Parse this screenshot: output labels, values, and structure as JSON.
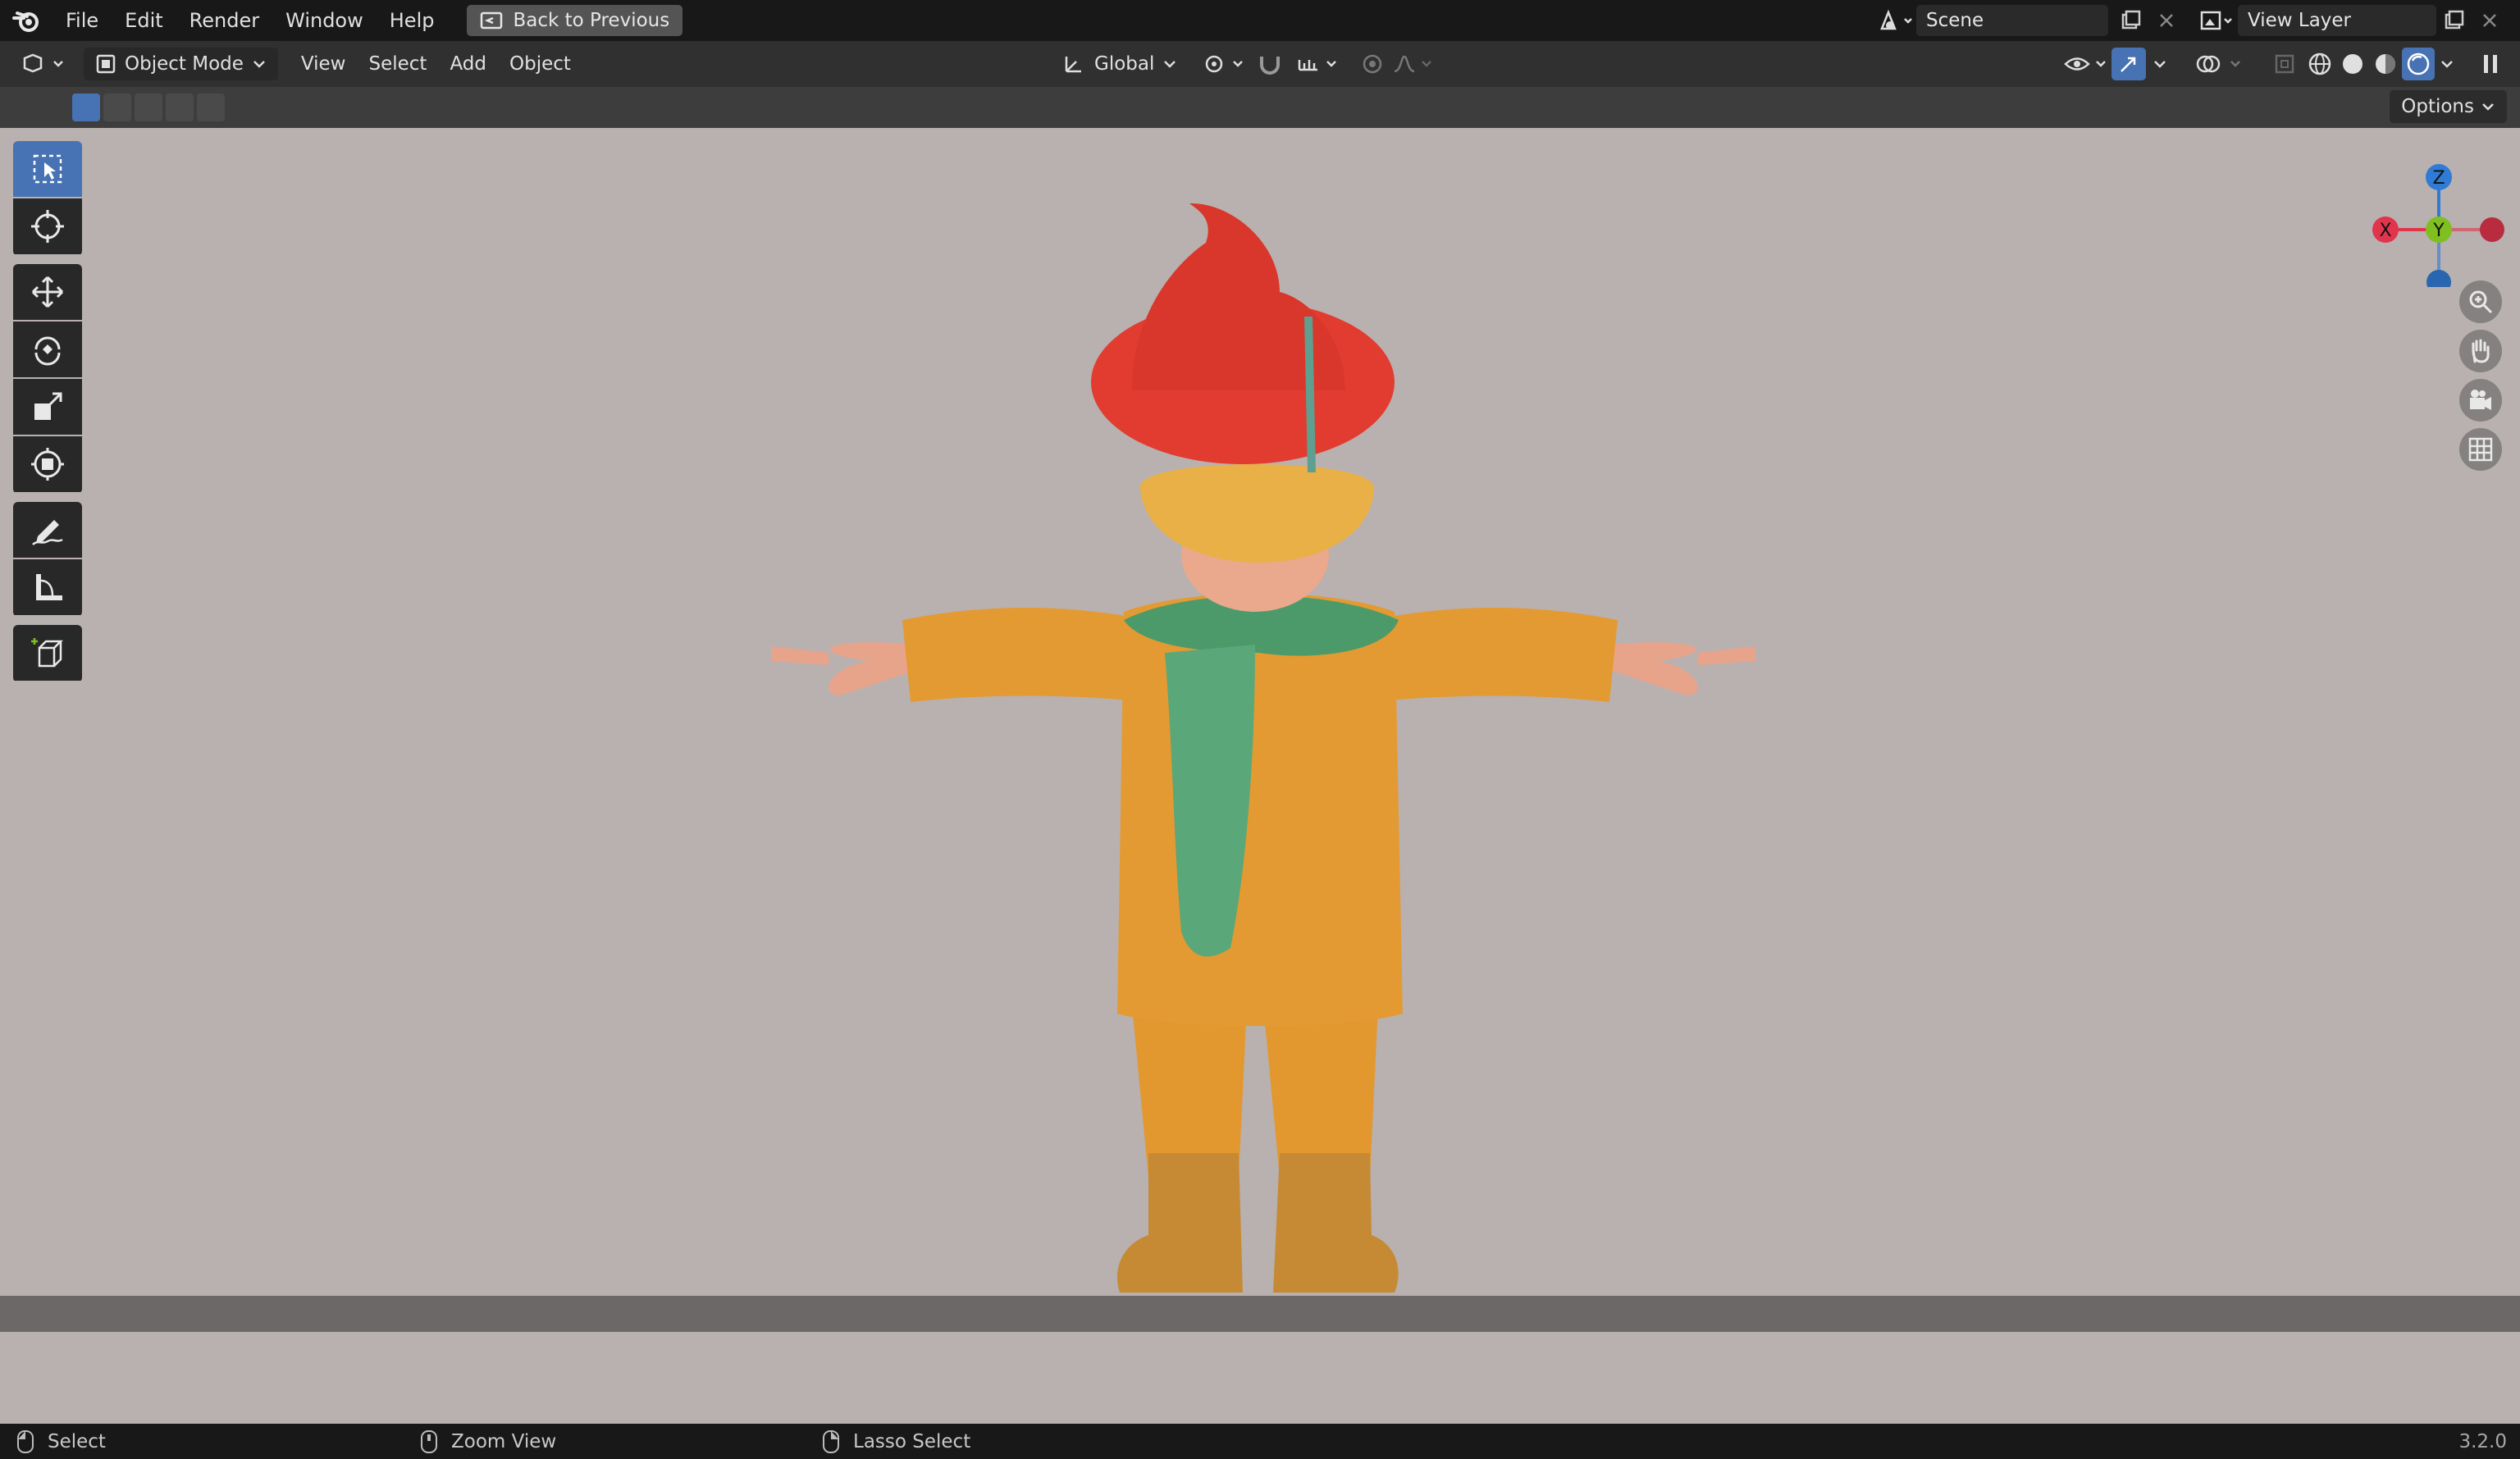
{
  "topbar": {
    "menus": [
      "File",
      "Edit",
      "Render",
      "Window",
      "Help"
    ],
    "back_label": "Back to Previous",
    "scene_label": "Scene",
    "view_layer_label": "View Layer"
  },
  "header": {
    "mode_label": "Object Mode",
    "menus": [
      "View",
      "Select",
      "Add",
      "Object"
    ],
    "orientation_label": "Global"
  },
  "tool_header": {
    "options_label": "Options"
  },
  "gizmo": {
    "z": "Z",
    "y": "Y",
    "x": "X"
  },
  "status": {
    "select": "Select",
    "zoom": "Zoom View",
    "lasso": "Lasso Select",
    "version": "3.2.0"
  },
  "colors": {
    "accent": "#4772b3",
    "axis_x": "#e0354c",
    "axis_y": "#7fbf1f",
    "axis_z": "#2f7bd6"
  }
}
